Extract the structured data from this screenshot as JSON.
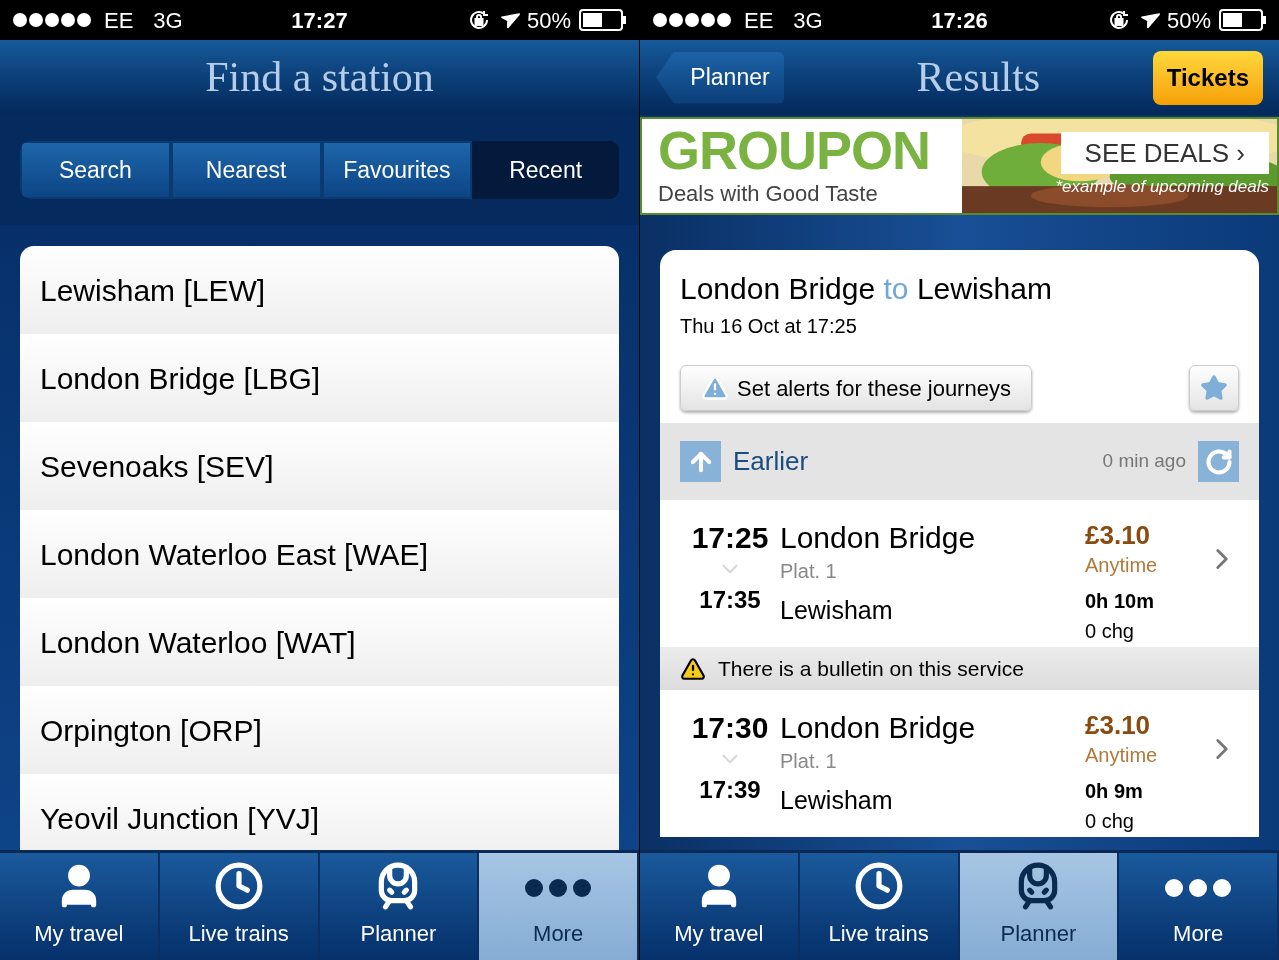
{
  "screens": [
    {
      "kind": "stations",
      "status_bar": {
        "carrier": "EE",
        "network": "3G",
        "time": "17:27",
        "battery": "50%"
      },
      "title": "Find a station",
      "tabs": [
        {
          "label": "Search",
          "selected": false
        },
        {
          "label": "Nearest",
          "selected": false
        },
        {
          "label": "Favourites",
          "selected": false
        },
        {
          "label": "Recent",
          "selected": true
        }
      ],
      "stations": [
        "Lewisham [LEW]",
        "London Bridge [LBG]",
        "Sevenoaks [SEV]",
        "London Waterloo East [WAE]",
        "London Waterloo [WAT]",
        "Orpington [ORP]",
        "Yeovil Junction [YVJ]"
      ],
      "tab_bar": [
        {
          "label": "My travel",
          "selected": false
        },
        {
          "label": "Live trains",
          "selected": false
        },
        {
          "label": "Planner",
          "selected": false
        },
        {
          "label": "More",
          "selected": true
        }
      ]
    },
    {
      "kind": "results",
      "status_bar": {
        "carrier": "EE",
        "network": "3G",
        "time": "17:26",
        "battery": "50%"
      },
      "back_button": "Planner",
      "title": "Results",
      "action_button": "Tickets",
      "ad": {
        "logo": "GROUPON",
        "tagline": "Deals with Good Taste",
        "cta": "SEE DEALS ›",
        "note": "*example of upcoming deals"
      },
      "journey": {
        "from": "London Bridge",
        "connector": "to",
        "to": "Lewisham",
        "date": "Thu 16 Oct at 17:25"
      },
      "alert_button": "Set alerts for these journeys",
      "earlier": {
        "label": "Earlier",
        "updated": "0 min ago"
      },
      "rows": [
        {
          "kind": "journey",
          "depart": "17:25",
          "from": "London Bridge",
          "platform": "Plat. 1",
          "arrive": "17:35",
          "to": "Lewisham",
          "price": "£3.10",
          "fare": "Anytime",
          "duration": "0h 10m",
          "changes": "0 chg"
        },
        {
          "kind": "bulletin",
          "text": "There is a bulletin on this service"
        },
        {
          "kind": "journey",
          "depart": "17:30",
          "from": "London Bridge",
          "platform": "Plat. 1",
          "arrive": "17:39",
          "to": "Lewisham",
          "price": "£3.10",
          "fare": "Anytime",
          "duration": "0h 9m",
          "changes": "0 chg"
        }
      ],
      "tab_bar": [
        {
          "label": "My travel",
          "selected": false
        },
        {
          "label": "Live trains",
          "selected": false
        },
        {
          "label": "Planner",
          "selected": true
        },
        {
          "label": "More",
          "selected": false
        }
      ]
    }
  ]
}
